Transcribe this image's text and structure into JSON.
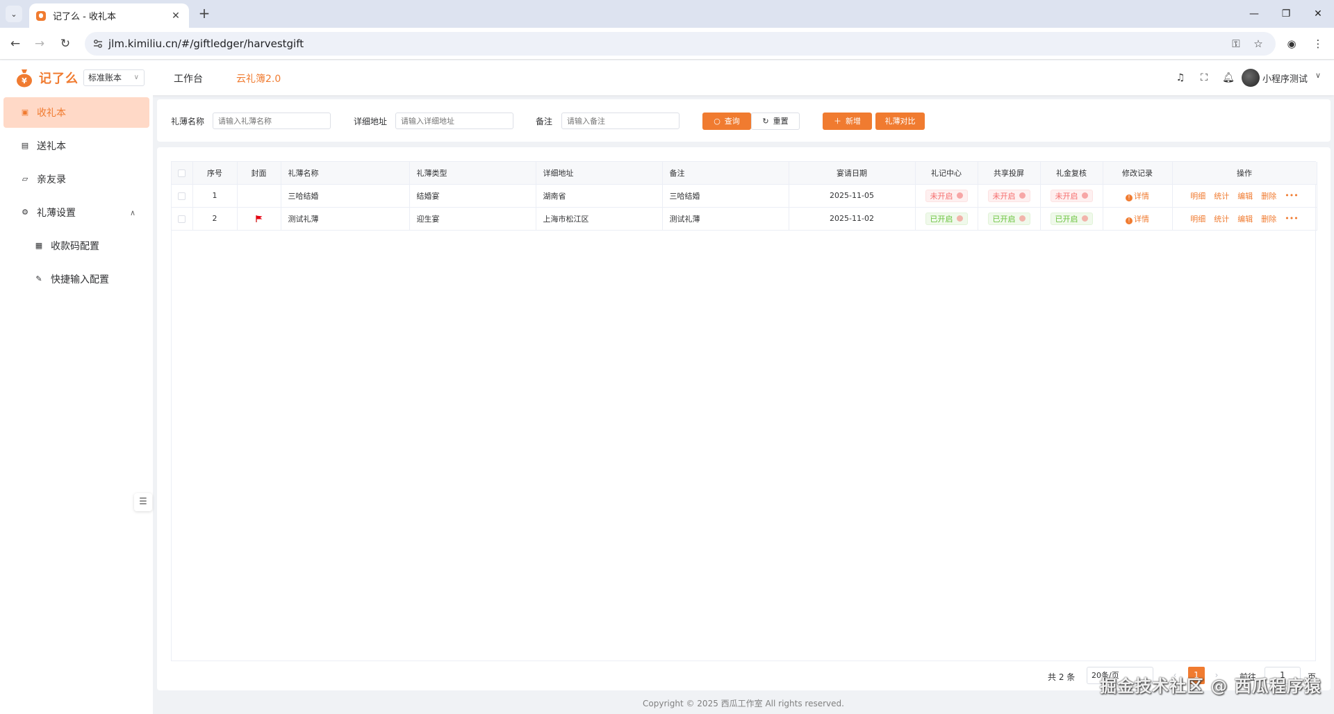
{
  "browser": {
    "tab_title": "记了么 - 收礼本",
    "url": "jlm.kimiliu.cn/#/giftledger/harvestgift"
  },
  "header": {
    "logo_text": "记了么",
    "ledger_type": "标准账本",
    "nav": [
      "工作台",
      "云礼簿2.0"
    ],
    "username": "小程序测试"
  },
  "sidebar": {
    "items": [
      {
        "label": "收礼本",
        "icon": "gift-icon",
        "active": true
      },
      {
        "label": "送礼本",
        "icon": "card-icon"
      },
      {
        "label": "亲友录",
        "icon": "folder-icon"
      },
      {
        "label": "礼薄设置",
        "icon": "gear-icon",
        "expanded": true
      },
      {
        "label": "收款码配置",
        "icon": "qrcode-icon",
        "sub": true
      },
      {
        "label": "快捷输入配置",
        "icon": "edit-icon",
        "sub": true
      }
    ]
  },
  "filter": {
    "name_label": "礼薄名称",
    "name_placeholder": "请输入礼薄名称",
    "address_label": "详细地址",
    "address_placeholder": "请输入详细地址",
    "remark_label": "备注",
    "remark_placeholder": "请输入备注",
    "search_label": "查询",
    "reset_label": "重置",
    "add_label": "新增",
    "compare_label": "礼薄对比"
  },
  "table": {
    "columns": [
      "序号",
      "封面",
      "礼薄名称",
      "礼薄类型",
      "详细地址",
      "备注",
      "宴请日期",
      "礼记中心",
      "共享投屏",
      "礼金复核",
      "修改记录",
      "操作"
    ],
    "rows": [
      {
        "index": "1",
        "cover": "",
        "name": "三哈结婚",
        "type": "结婚宴",
        "address": "湖南省",
        "remark": "三哈结婚",
        "date": "2025-11-05",
        "center": "未开启",
        "share": "未开启",
        "review": "未开启",
        "center_on": false,
        "share_on": false,
        "review_on": false,
        "history": "详情"
      },
      {
        "index": "2",
        "cover": "flag-icon",
        "name": "测试礼薄",
        "type": "迎生宴",
        "address": "上海市松江区",
        "remark": "测试礼薄",
        "date": "2025-11-02",
        "center": "已开启",
        "share": "已开启",
        "review": "已开启",
        "center_on": true,
        "share_on": true,
        "review_on": true,
        "history": "详情"
      }
    ],
    "actions": [
      "明细",
      "统计",
      "编辑",
      "删除"
    ]
  },
  "pagination": {
    "total": "共 2 条",
    "page_size": "20条/页",
    "current_page": "1",
    "goto_label": "前往",
    "goto_value": "1",
    "page_suffix": "页"
  },
  "watermark": "掘金技术社区 @ 西瓜程序猿",
  "footer": "Copyright © 2025 西瓜工作室 All rights reserved.",
  "colors": {
    "accent": "#f07b30",
    "active_bg": "#ffd9c7",
    "status_on": "#67c23a",
    "status_off": "#f56c6c"
  }
}
